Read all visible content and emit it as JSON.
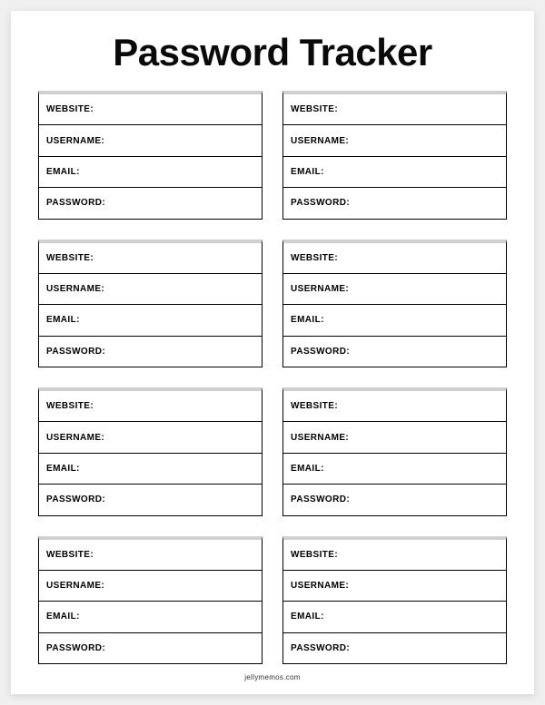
{
  "title": "Password Tracker",
  "fields": {
    "website": "WEBSITE:",
    "username": "USERNAME:",
    "email": "EMAIL:",
    "password": "PASSWORD:"
  },
  "footer": "jellymemos.com"
}
